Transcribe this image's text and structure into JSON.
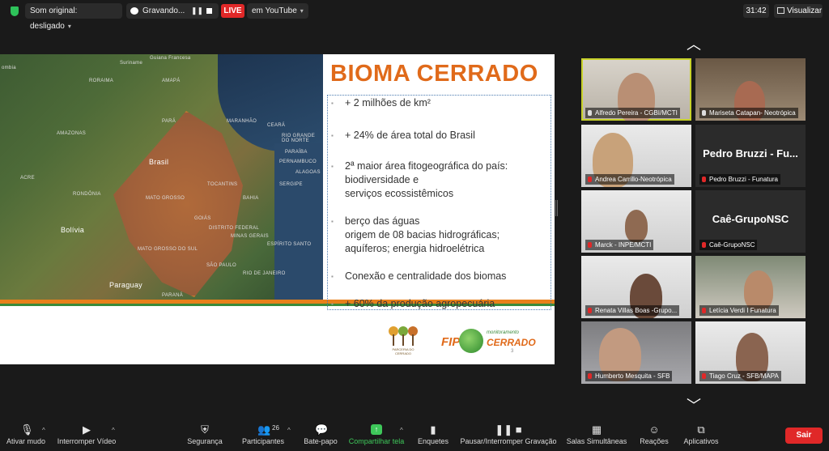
{
  "topbar": {
    "audio_label": "Som original: desligado",
    "recording_label": "Gravando...",
    "live_label": "LIVE",
    "youtube_label": "em YouTube",
    "time": "31:42",
    "view_label": "Visualizar"
  },
  "slide": {
    "title": "BIOMA CERRADO",
    "bullets": [
      [
        "+ 2 milhões de km²"
      ],
      [
        "+ 24% de área total do Brasil"
      ],
      [
        "2ª maior área fitogeográfica do país:",
        "biodiversidade e",
        "serviços ecossistêmicos"
      ],
      [
        "berço das águas",
        "origem de 08 bacias hidrográficas;",
        "aquíferos; energia hidroelétrica"
      ],
      [
        "Conexão e centralidade dos biomas"
      ],
      [
        "+ 60% da produção agropecuária"
      ]
    ],
    "map_labels": [
      "ombia",
      "Guiana Francesa",
      "Suriname",
      "AMAPÁ",
      "RORAIMA",
      "AMAZONAS",
      "PARÁ",
      "MARANHÃO",
      "CEARÁ",
      "RIO GRANDE DO NORTE",
      "PARAÍBA",
      "PERNAMBUCO",
      "ALAGOAS",
      "SERGIPE",
      "Brasil",
      "ACRE",
      "RONDÔNIA",
      "TOCANTINS",
      "BAHIA",
      "MATO GROSSO",
      "Bolívia",
      "GOIÁS",
      "DISTRITO FEDERAL",
      "MINAS GERAIS",
      "ESPÍRITO SANTO",
      "MATO GROSSO DO SUL",
      "SÃO PAULO",
      "RIO DE JANEIRO",
      "Paraguay",
      "PARANÁ"
    ],
    "logo1_caption": "PARCERIA DO CERRADO",
    "logo2_fip": "FIP",
    "logo2_monitoramento": "monitoramento",
    "logo2_cerrado": "CERRADO",
    "logo2_num": "3"
  },
  "participants": [
    {
      "name": "Alfredo Pereira - CGBI/MCTI",
      "video": true,
      "muted": false,
      "active": true
    },
    {
      "name": "Mariseta Catapan- Neotrópica",
      "video": true,
      "muted": false
    },
    {
      "name": "Andrea Carrillo-Neotrópica",
      "video": true,
      "muted": true
    },
    {
      "name": "Pedro Bruzzi - Funatura",
      "display": "Pedro Bruzzi - Fu...",
      "video": false,
      "muted": true
    },
    {
      "name": "Marck - INPE/MCTI",
      "video": true,
      "muted": true
    },
    {
      "name": "Caê-GrupoNSC",
      "display": "Caê-GrupoNSC",
      "video": false,
      "muted": true
    },
    {
      "name": "Renata Villas Boas -Grupo...",
      "video": true,
      "muted": true
    },
    {
      "name": "Letícia Verdi I Funatura",
      "video": true,
      "muted": true
    },
    {
      "name": "Humberto Mesquita - SFB",
      "video": true,
      "muted": true
    },
    {
      "name": "Tiago Cruz - SFB/MAPA",
      "video": true,
      "muted": true
    }
  ],
  "toolbar": {
    "mute": "Ativar mudo",
    "video": "Interromper Vídeo",
    "security": "Segurança",
    "participants": "Participantes",
    "participants_count": "26",
    "chat": "Bate-papo",
    "share": "Compartilhar tela",
    "polls": "Enquetes",
    "record": "Pausar/Interromper Gravação",
    "breakout": "Salas Simultâneas",
    "reactions": "Reações",
    "apps": "Aplicativos",
    "leave": "Sair"
  }
}
